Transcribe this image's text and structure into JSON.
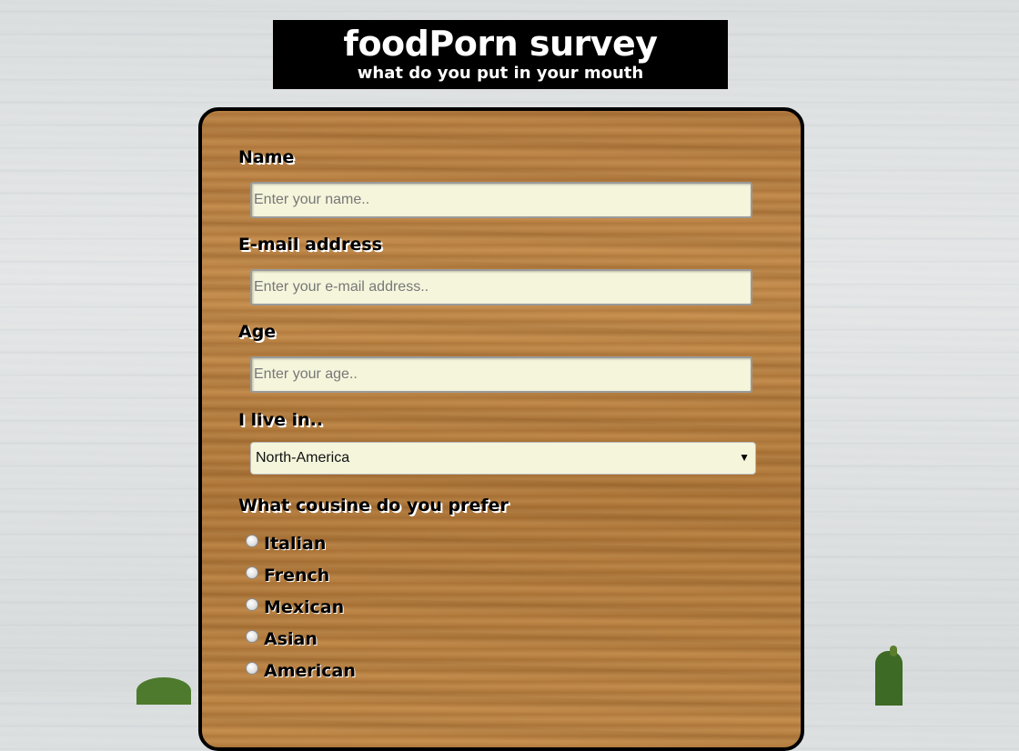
{
  "header": {
    "title": "foodPorn survey",
    "subtitle": "what do you put in your mouth"
  },
  "form": {
    "name": {
      "label": "Name",
      "placeholder": "Enter your name..",
      "value": ""
    },
    "email": {
      "label": "E-mail address",
      "placeholder": "Enter your e-mail address..",
      "value": ""
    },
    "age": {
      "label": "Age",
      "placeholder": "Enter your age..",
      "value": ""
    },
    "location": {
      "label": "I live in..",
      "selected": "North-America"
    },
    "cuisine": {
      "label": "What cousine do you prefer",
      "options": [
        "Italian",
        "French",
        "Mexican",
        "Asian",
        "American"
      ]
    }
  },
  "icons": {
    "select_arrow": "dropdown-arrow-icon"
  }
}
